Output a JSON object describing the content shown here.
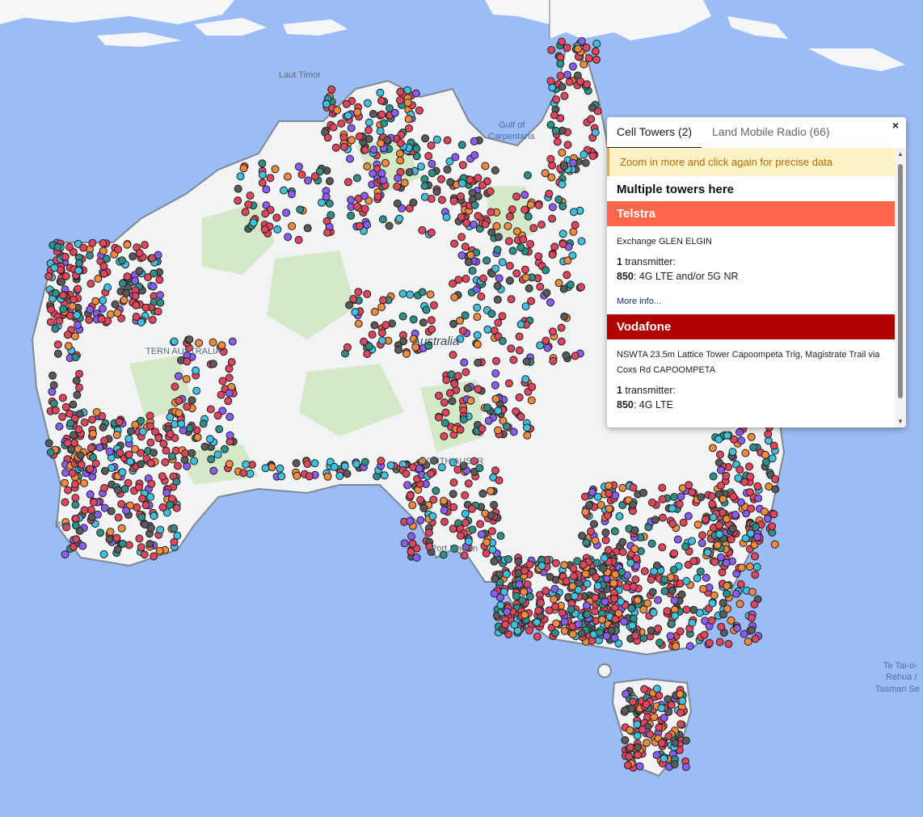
{
  "map": {
    "labels": {
      "laut_timor": "Laut Timor",
      "gulf": "Gulf of",
      "carpentaria": "Carpentaria",
      "australia": "Australia",
      "western_australia": "TERN AUSTRALIA",
      "south_australia": "SOUTH AUSTR",
      "port_lincoln": "Port Lincoln",
      "bunbury": "Bun",
      "tasman_1": "Te Tai-o-",
      "tasman_2": "Rehua /",
      "tasman_3": "Tasman Se"
    },
    "colors": {
      "ocean": "#9cbcf5",
      "land": "#f1f3f4",
      "park": "#d5e8c8",
      "coast": "#7f8790"
    },
    "marker_colors": {
      "telstra": "#e0455e",
      "optus": "#f08a3c",
      "vodafone_tpg": "#8a5cf0",
      "other": "#5a5a5a",
      "shared": "#3fc0e0",
      "teal": "#2f8f88"
    }
  },
  "popup": {
    "tabs": [
      "Cell Towers (2)",
      "Land Mobile Radio (66)"
    ],
    "close_label": "×",
    "notice": "Zoom in more and click again for precise data",
    "heading": "Multiple towers here",
    "carriers": [
      {
        "name": "Telstra",
        "color": "#ff674b",
        "site": "Exchange GLEN ELGIN",
        "tx_count": "1",
        "tx_label": " transmitter:",
        "band": "850",
        "tech": ": 4G LTE and/or 5G NR",
        "more": "More info..."
      },
      {
        "name": "Vodafone",
        "color": "#b00000",
        "site": "NSWTA 23.5m Lattice Tower Capoompeta Trig, Magistrate Trail via Coxs Rd CAPOOMPETA",
        "tx_count": "1",
        "tx_label": " transmitter:",
        "band": "850",
        "tech": ": 4G LTE"
      }
    ]
  }
}
